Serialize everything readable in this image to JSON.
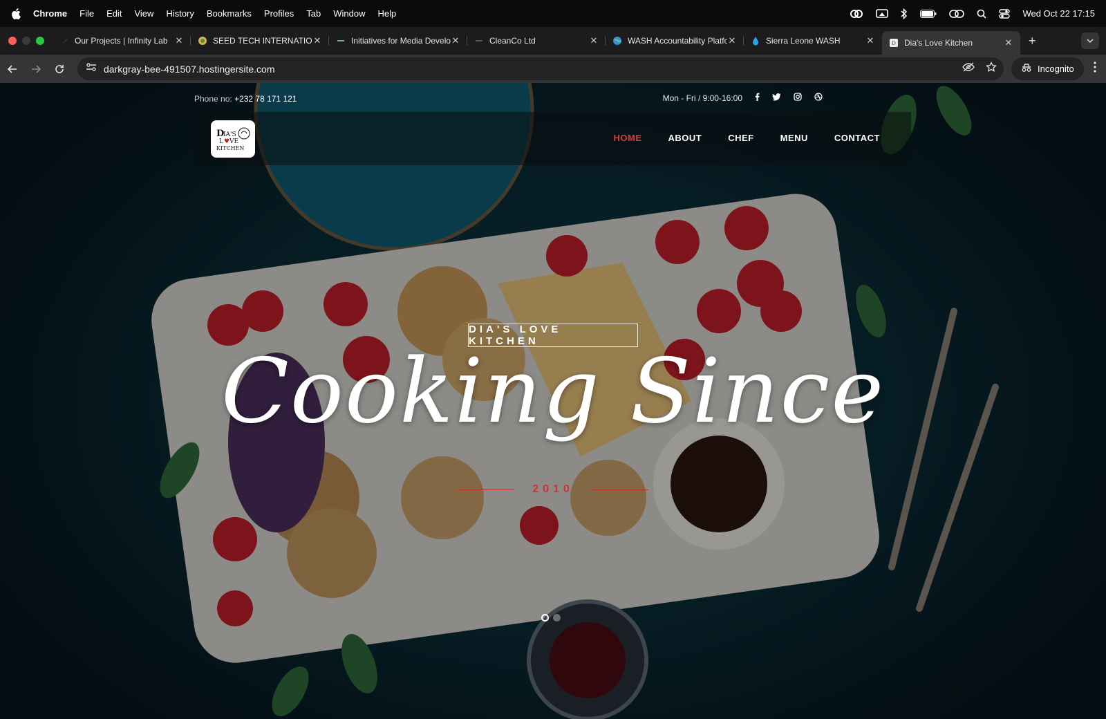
{
  "menubar": {
    "app": "Chrome",
    "items": [
      "File",
      "Edit",
      "View",
      "History",
      "Bookmarks",
      "Profiles",
      "Tab",
      "Window",
      "Help"
    ],
    "clock": "Wed Oct 22  17:15"
  },
  "tabs": [
    {
      "title": "Our Projects | Infinity Lab",
      "icon": "bird-icon",
      "active": false
    },
    {
      "title": "SEED TECH INTERNATIONAL",
      "icon": "globe-icon",
      "active": false
    },
    {
      "title": "Initiatives for Media Development",
      "icon": "leaf-icon",
      "active": false
    },
    {
      "title": "CleanCo Ltd",
      "icon": "dash-icon",
      "active": false
    },
    {
      "title": "WASH Accountability Platform",
      "icon": "globe-icon",
      "active": false
    },
    {
      "title": "Sierra Leone WASH",
      "icon": "water-drop-icon",
      "active": false
    },
    {
      "title": "Dia's Love Kitchen",
      "icon": "kitchen-icon",
      "active": true
    }
  ],
  "address": {
    "url": "darkgray-bee-491507.hostingersite.com",
    "incognito_label": "Incognito"
  },
  "site": {
    "phone_label": "Phone no:",
    "phone": "+232 78 171 121",
    "hours": "Mon - Fri / 9:00-16:00",
    "logo_text": "Dia's Love Kitchen",
    "nav": [
      "HOME",
      "ABOUT",
      "CHEF",
      "MENU",
      "CONTACT"
    ],
    "kicker": "DIA'S LOVE KITCHEN",
    "headline": "Cooking Since",
    "year": "2010"
  },
  "colors": {
    "accent": "#e03a3a",
    "background": "#0a2b36"
  }
}
